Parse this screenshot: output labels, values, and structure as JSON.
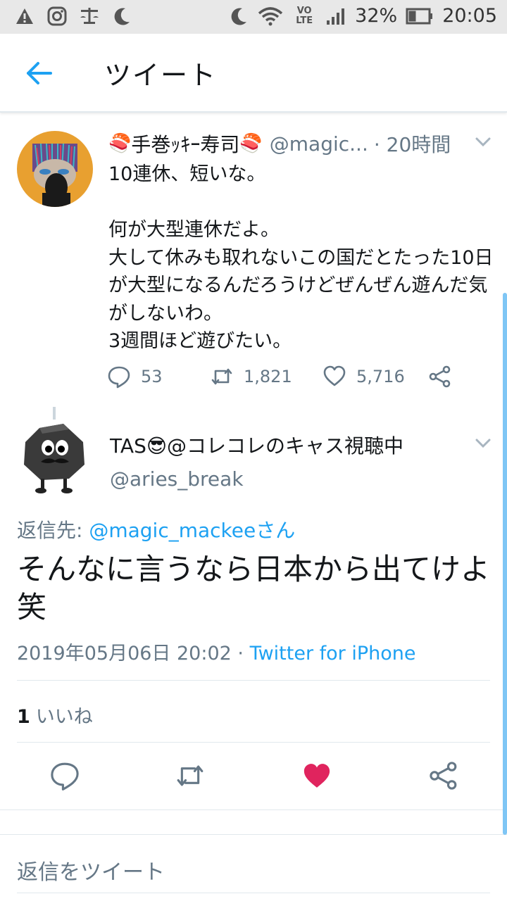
{
  "status_bar": {
    "battery": "32%",
    "time": "20:05",
    "network": "LTE"
  },
  "header": {
    "title": "ツイート"
  },
  "original_tweet": {
    "name": "手巻ｯｷｰ寿司",
    "handle": "@magic...",
    "time": "· 20時間",
    "text": "10連休、短いな。\n\n何が大型連休だよ。\n大して休みも取れないこの国だとたった10日が大型になるんだろうけどぜんぜん遊んだ気がしないわ。\n3週間ほど遊びたい。",
    "replies": "53",
    "retweets": "1,821",
    "likes": "5,716"
  },
  "reply_tweet": {
    "name": "TAS😎@コレコレのキャス視聴中",
    "handle": "@aries_break",
    "reply_to_label": "返信先: ",
    "reply_to_user": "@magic_mackeeさん",
    "text": "そんなに言うなら日本から出てけよ笑",
    "date": "2019年05月06日 20:02",
    "via_sep": " · ",
    "via": "Twitter for iPhone",
    "like_count": "1",
    "like_label": "いいね"
  },
  "reply_box": {
    "placeholder": "返信をツイート"
  },
  "colors": {
    "accent": "#1da1f2",
    "like": "#e0245e",
    "secondary_text": "#657786"
  }
}
